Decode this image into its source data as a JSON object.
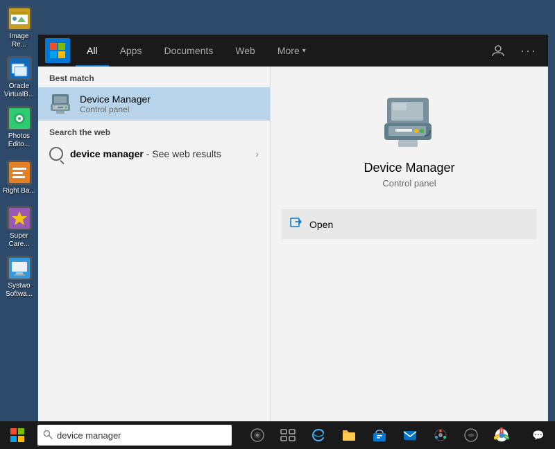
{
  "nav": {
    "tabs": [
      {
        "id": "all",
        "label": "All",
        "active": true
      },
      {
        "id": "apps",
        "label": "Apps",
        "active": false
      },
      {
        "id": "documents",
        "label": "Documents",
        "active": false
      },
      {
        "id": "web",
        "label": "Web",
        "active": false
      },
      {
        "id": "more",
        "label": "More",
        "active": false,
        "hasChevron": true
      }
    ],
    "actions": {
      "person_icon": "👤",
      "ellipsis_icon": "···"
    }
  },
  "results": {
    "best_match_label": "Best match",
    "best_match": {
      "title": "Device Manager",
      "subtitle": "Control panel"
    },
    "web_search_label": "Search the web",
    "web_search": {
      "query": "device manager",
      "suffix": " - See web results"
    }
  },
  "detail": {
    "title": "Device Manager",
    "subtitle": "Control panel",
    "actions": [
      {
        "label": "Open"
      }
    ]
  },
  "taskbar": {
    "search_text": "device manager",
    "search_placeholder": "device manager",
    "icons": [
      "🌐",
      "🗂",
      "🛒",
      "✉",
      "🎨",
      "🎮",
      "🌐"
    ]
  },
  "desktop_icons": [
    {
      "id": "image-re",
      "label": "Image Re...",
      "emoji": "🖼"
    },
    {
      "id": "virtualbox",
      "label": "Oracle Virt...",
      "emoji": "📦"
    },
    {
      "id": "photos",
      "label": "Photos\nEdito...",
      "emoji": "📷"
    },
    {
      "id": "rightba",
      "label": "Right Ba...",
      "emoji": "🔧"
    },
    {
      "id": "supercare",
      "label": "Super\nCare...",
      "emoji": "⭐"
    },
    {
      "id": "systwo",
      "label": "Systwo\nSoftwa...",
      "emoji": "💻"
    }
  ]
}
